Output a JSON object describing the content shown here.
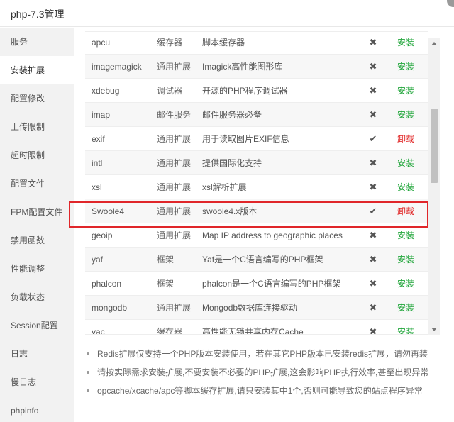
{
  "window": {
    "title": "php-7.3管理"
  },
  "sidebar": {
    "items": [
      {
        "label": "服务"
      },
      {
        "label": "安装扩展",
        "active": true
      },
      {
        "label": "配置修改"
      },
      {
        "label": "上传限制"
      },
      {
        "label": "超时限制"
      },
      {
        "label": "配置文件"
      },
      {
        "label": "FPM配置文件"
      },
      {
        "label": "禁用函数"
      },
      {
        "label": "性能调整"
      },
      {
        "label": "负载状态"
      },
      {
        "label": "Session配置"
      },
      {
        "label": "日志"
      },
      {
        "label": "慢日志"
      },
      {
        "label": "phpinfo"
      }
    ]
  },
  "extensions": {
    "rows": [
      {
        "name": "apcu",
        "type": "缓存器",
        "desc": "脚本缓存器",
        "status": "✖",
        "action": "安装"
      },
      {
        "name": "imagemagick",
        "type": "通用扩展",
        "desc": "Imagick高性能图形库",
        "status": "✖",
        "action": "安装"
      },
      {
        "name": "xdebug",
        "type": "调试器",
        "desc": "开源的PHP程序调试器",
        "status": "✖",
        "action": "安装"
      },
      {
        "name": "imap",
        "type": "邮件服务",
        "desc": "邮件服务器必备",
        "status": "✖",
        "action": "安装"
      },
      {
        "name": "exif",
        "type": "通用扩展",
        "desc": "用于读取图片EXIF信息",
        "status": "✔",
        "action": "卸载"
      },
      {
        "name": "intl",
        "type": "通用扩展",
        "desc": "提供国际化支持",
        "status": "✖",
        "action": "安装"
      },
      {
        "name": "xsl",
        "type": "通用扩展",
        "desc": "xsl解析扩展",
        "status": "✖",
        "action": "安装"
      },
      {
        "name": "Swoole4",
        "type": "通用扩展",
        "desc": "swoole4.x版本",
        "status": "✔",
        "action": "卸载"
      },
      {
        "name": "geoip",
        "type": "通用扩展",
        "desc": "Map IP address to geographic places",
        "status": "✖",
        "action": "安装"
      },
      {
        "name": "yaf",
        "type": "框架",
        "desc": "Yaf是一个C语言编写的PHP框架",
        "status": "✖",
        "action": "安装"
      },
      {
        "name": "phalcon",
        "type": "框架",
        "desc": "phalcon是一个C语言编写的PHP框架",
        "status": "✖",
        "action": "安装"
      },
      {
        "name": "mongodb",
        "type": "通用扩展",
        "desc": "Mongodb数据库连接驱动",
        "status": "✖",
        "action": "安装"
      },
      {
        "name": "yac",
        "type": "缓存器",
        "desc": "高性能无锁共享内存Cache",
        "status": "✖",
        "action": "安装"
      }
    ]
  },
  "notes": [
    "Redis扩展仅支持一个PHP版本安装使用，若在其它PHP版本已安装redis扩展，请勿再装",
    "请按实际需求安装扩展,不要安装不必要的PHP扩展,这会影响PHP执行效率,甚至出现异常",
    "opcache/xcache/apc等脚本缓存扩展,请只安装其中1个,否则可能导致您的站点程序异常"
  ],
  "colors": {
    "install": "#20a53a",
    "uninstall": "#e02020",
    "highlight": "#e0262a"
  },
  "icons": {
    "close": "close-icon",
    "installed": "check-icon",
    "not_installed": "cross-icon"
  }
}
